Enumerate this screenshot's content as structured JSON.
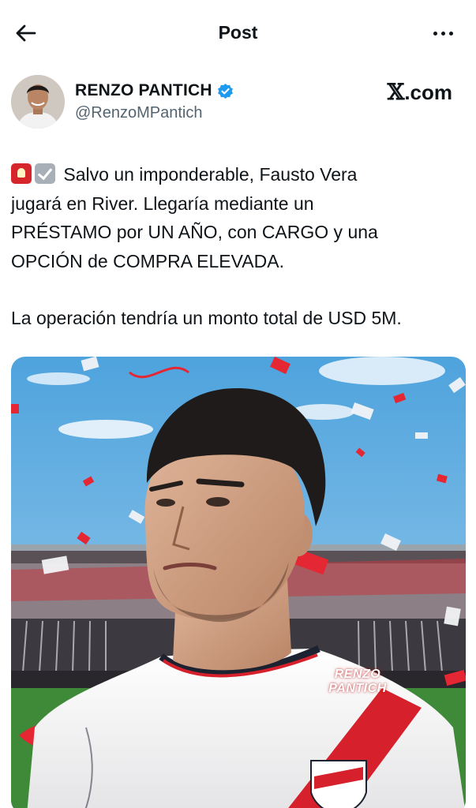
{
  "header": {
    "title": "Post"
  },
  "post": {
    "author": {
      "name": "RENZO PANTICH",
      "handle": "@RenzoMPantich",
      "verified": true
    },
    "source_badge": {
      "mark": "𝕏",
      "text": ".com"
    },
    "text_lines": [
      "Salvo un imponderable, Fausto Vera",
      "jugará en River. Llegaría mediante un",
      "PRÉSTAMO por UN AÑO, con CARGO y una",
      "OPCIÓN de COMPRA ELEVADA.",
      "La operación tendría un monto total de USD 5M."
    ],
    "emojis": [
      "siren-emoji",
      "check-box-emoji"
    ],
    "media": {
      "watermark_line1": "RENZO",
      "watermark_line2": "PANTICH"
    }
  },
  "colors": {
    "text": "#0f1419",
    "secondary": "#536471",
    "verified": "#1d9bf0",
    "river_red": "#d6202b"
  }
}
